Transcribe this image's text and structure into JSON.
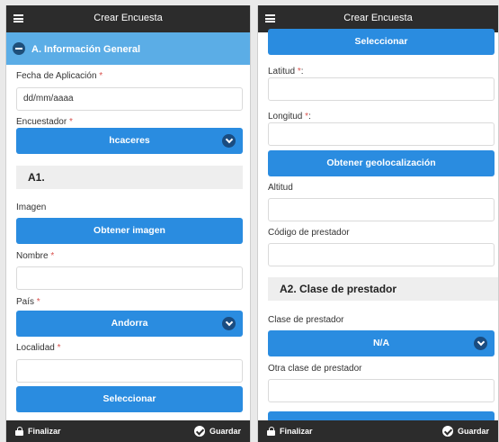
{
  "left": {
    "header_title": "Crear Encuesta",
    "section_title": "A. Información General",
    "fecha_label": "Fecha de Aplicación",
    "fecha_placeholder": "dd/mm/aaaa",
    "encuestador_label": "Encuestador",
    "encuestador_value": "hcaceres",
    "subsection_title": "A1.",
    "imagen_label": "Imagen",
    "obtener_imagen_label": "Obtener imagen",
    "nombre_label": "Nombre",
    "pais_label": "País",
    "pais_value": "Andorra",
    "localidad_label": "Localidad",
    "seleccionar_label": "Seleccionar",
    "finalizar_label": "Finalizar",
    "guardar_label": "Guardar"
  },
  "right": {
    "header_title": "Crear Encuesta",
    "seleccionar_label": "Seleccionar",
    "latitud_label": "Latitud",
    "longitud_label": "Longitud",
    "geoloc_label": "Obtener geolocalización",
    "altitud_label": "Altitud",
    "codigo_label": "Código de prestador",
    "subsection_title": "A2. Clase de prestador",
    "clase_label": "Clase de prestador",
    "clase_value": "N/A",
    "otra_clase_label": "Otra clase de prestador",
    "finalizar_label": "Finalizar",
    "guardar_label": "Guardar"
  },
  "required_marker": "*",
  "colors": {
    "primary_button": "#2a8ce0",
    "section_header": "#5bade6",
    "topbar": "#2c2c2c",
    "required": "#d9534f"
  }
}
